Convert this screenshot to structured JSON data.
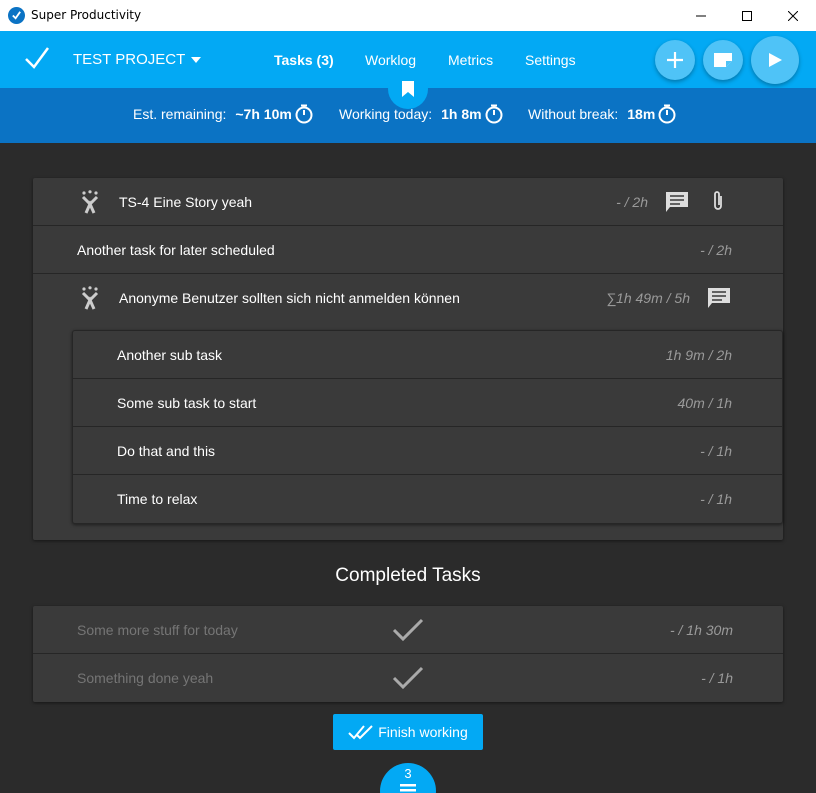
{
  "window": {
    "title": "Super Productivity"
  },
  "toolbar": {
    "project": "TEST PROJECT",
    "nav": [
      "Tasks (3)",
      "Worklog",
      "Metrics",
      "Settings"
    ]
  },
  "stats": {
    "est_label": "Est. remaining:",
    "est_value": "~7h 10m",
    "working_label": "Working today:",
    "working_value": "1h 8m",
    "break_label": "Without break:",
    "break_value": "18m"
  },
  "tasks": [
    {
      "title": "TS-4 Eine Story yeah",
      "time": "- / 2h",
      "jira": true
    },
    {
      "title": "Another task for later scheduled",
      "time": "- / 2h",
      "jira": false
    },
    {
      "title": "Anonyme Benutzer sollten sich nicht anmelden können",
      "time": "∑1h 49m / 5h",
      "jira": true
    }
  ],
  "subtasks": [
    {
      "title": "Another sub task",
      "time": "1h 9m / 2h"
    },
    {
      "title": "Some sub task to start",
      "time": "40m / 1h"
    },
    {
      "title": "Do that and this",
      "time": "- / 1h"
    },
    {
      "title": "Time to relax",
      "time": "- / 1h"
    }
  ],
  "completed": {
    "heading": "Completed Tasks",
    "items": [
      {
        "title": "Some more stuff for today",
        "time": "- / 1h 30m"
      },
      {
        "title": "Something done yeah",
        "time": "- / 1h"
      }
    ]
  },
  "finish_label": "Finish working",
  "counter": "3",
  "colors": {
    "primary": "#03a9f4",
    "primary_dark": "#0b73c4",
    "background": "#2b2b2b",
    "card": "#3a3a3a"
  }
}
